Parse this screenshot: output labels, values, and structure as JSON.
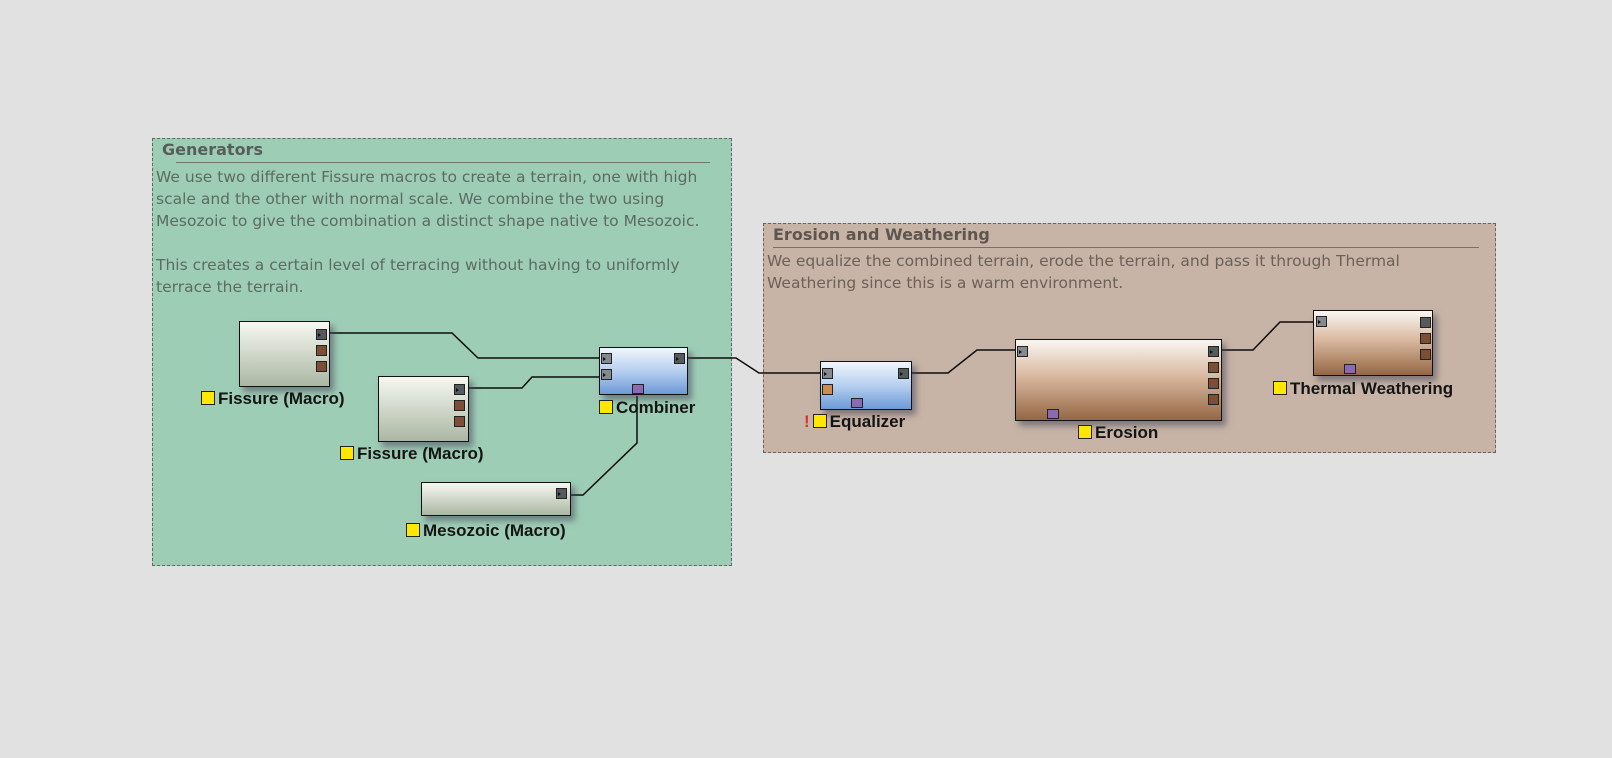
{
  "groups": {
    "generators": {
      "title": "Generators",
      "description": "We use two different Fissure macros to create a terrain, one with high\nscale and the other with normal scale. We combine the two using\nMesozoic to give the combination a distinct shape native to Mesozoic.\n\nThis creates a certain level of terracing without having to uniformly\nterrace the terrain."
    },
    "erosion": {
      "title": "Erosion and Weathering",
      "description": "We equalize the combined terrain, erode the terrain, and pass it through Thermal\nWeathering since this is a warm environment."
    }
  },
  "nodes": {
    "fissure1": {
      "label": "Fissure (Macro)"
    },
    "fissure2": {
      "label": "Fissure (Macro)"
    },
    "mesozoic": {
      "label": "Mesozoic (Macro)"
    },
    "combiner": {
      "label": "Combiner"
    },
    "equalizer": {
      "label": "Equalizer",
      "warning": "!"
    },
    "erosion": {
      "label": "Erosion"
    },
    "thermal": {
      "label": "Thermal Weathering"
    }
  },
  "colors": {
    "generators_bg": "#9ecdb6",
    "erosion_bg": "#c7b4a6",
    "canvas_bg": "#e1e1e1",
    "node_indicator": "#ffe700"
  }
}
